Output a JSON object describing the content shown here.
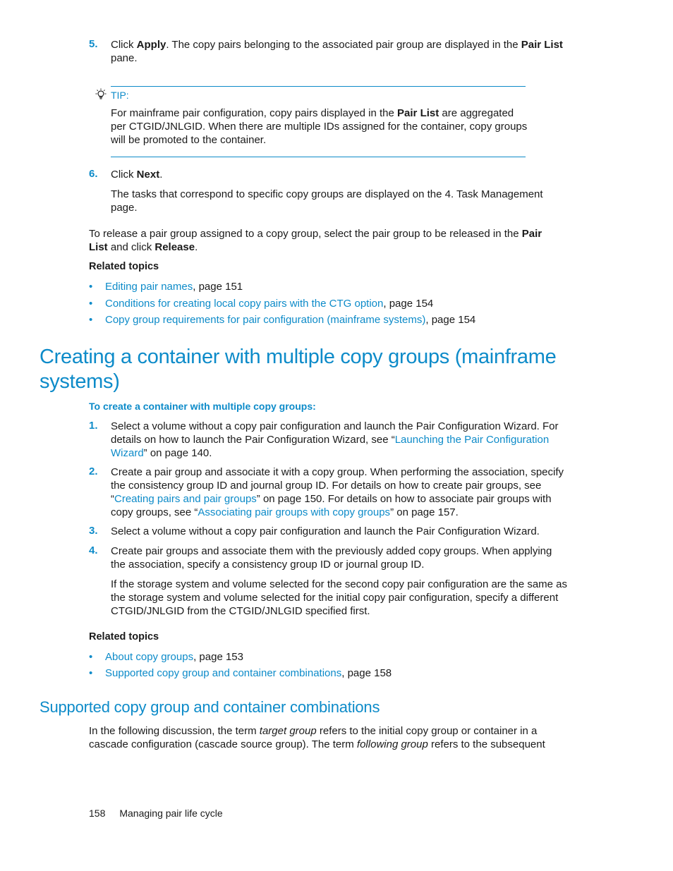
{
  "step5": {
    "number": "5.",
    "pre": "Click ",
    "apply": "Apply",
    "mid": ". The copy pairs belonging to the associated pair group are displayed in the ",
    "pair_list": "Pair List",
    "post": " pane."
  },
  "tip": {
    "icon": "lightbulb-icon",
    "label": "TIP:",
    "pre": "For mainframe pair configuration, copy pairs displayed in the ",
    "pair_list": "Pair List",
    "post": " are aggregated per CTGID/JNLGID. When there are multiple IDs assigned for the container, copy groups will be promoted to the container."
  },
  "step6": {
    "number": "6.",
    "pre": "Click ",
    "next": "Next",
    "post": ".",
    "detail": "The tasks that correspond to specific copy groups are displayed on the 4. Task Management page."
  },
  "release_para": {
    "pre": "To release a pair group assigned to a copy group, select the pair group to be released in the ",
    "pair_list": "Pair List",
    "mid": " and click ",
    "release": "Release",
    "post": "."
  },
  "related1": {
    "title": "Related topics",
    "items": [
      {
        "link": "Editing pair names",
        "suffix": ", page 151"
      },
      {
        "link": "Conditions for creating local copy pairs with the CTG option",
        "suffix": ", page 154"
      },
      {
        "link": "Copy group requirements for pair configuration (mainframe systems)",
        "suffix": ", page 154"
      }
    ]
  },
  "section1": {
    "title": "Creating a container with multiple copy groups (mainframe systems)",
    "procedure_title": "To create a container with multiple copy groups:",
    "steps": [
      {
        "number": "1.",
        "pre": "Select a volume without a copy pair configuration and launch the Pair Configuration Wizard. For details on how to launch the Pair Configuration Wizard, see “",
        "link": "Launching the Pair Configuration Wizard",
        "post": "” on page 140."
      },
      {
        "number": "2.",
        "pre": "Create a pair group and associate it with a copy group. When performing the association, specify the consistency group ID and journal group ID. For details on how to create pair groups, see “",
        "link": "Creating pairs and pair groups",
        "mid": "” on page 150. For details on how to associate pair groups with copy groups, see “",
        "link2": "Associating pair groups with copy groups",
        "post": "” on page 157."
      },
      {
        "number": "3.",
        "text": "Select a volume without a copy pair configuration and launch the Pair Configuration Wizard."
      },
      {
        "number": "4.",
        "text": "Create pair groups and associate them with the previously added copy groups. When applying the association, specify a consistency group ID or journal group ID.",
        "detail": "If the storage system and volume selected for the second copy pair configuration are the same as the storage system and volume selected for the initial copy pair configuration, specify a different CTGID/JNLGID  from the CTGID/JNLGID specified first."
      }
    ]
  },
  "related2": {
    "title": "Related topics",
    "items": [
      {
        "link": "About copy groups",
        "suffix": ", page 153"
      },
      {
        "link": "Supported copy group and container combinations",
        "suffix": ", page 158"
      }
    ]
  },
  "section2": {
    "title": "Supported copy group and container combinations",
    "p1": "In the following discussion, the term ",
    "term1": "target group",
    "p2": " refers to the initial copy group or container in a cascade configuration (cascade source group). The term ",
    "term2": "following group",
    "p3": " refers to the subsequent"
  },
  "footer": {
    "page_number": "158",
    "chapter": "Managing pair life cycle"
  },
  "colors": {
    "accent": "#0d8bc9",
    "text": "#1a1a1a"
  }
}
